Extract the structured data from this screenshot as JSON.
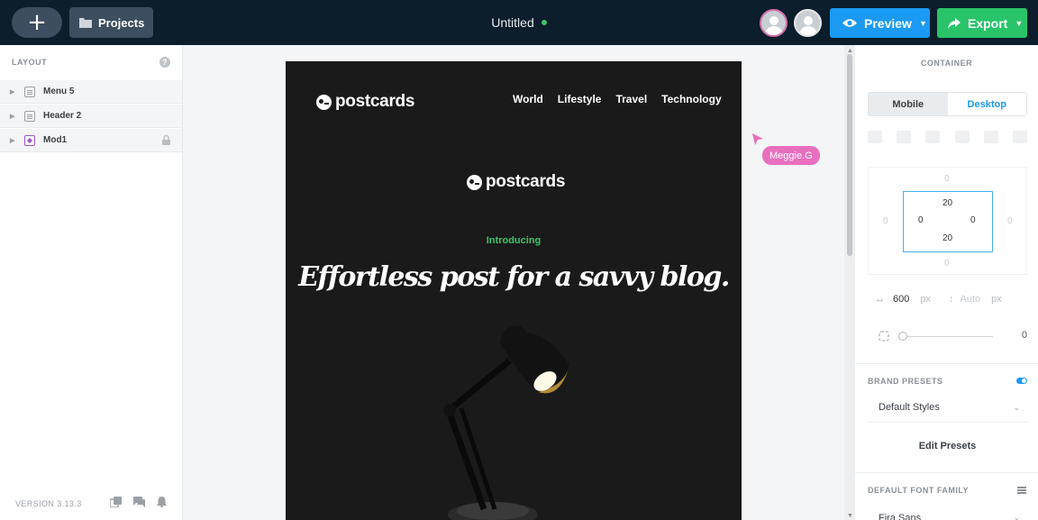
{
  "topbar": {
    "add_icon": "plus-icon",
    "projects_label": "Projects",
    "doc_title": "Untitled",
    "status_color": "#3cc46a",
    "preview_label": "Preview",
    "export_label": "Export",
    "preview_color": "#1a9af2",
    "export_color": "#29c46a"
  },
  "layout_panel": {
    "title": "LAYOUT",
    "help": "?",
    "layers": [
      {
        "label": "Menu 5",
        "icon": "section-icon"
      },
      {
        "label": "Header 2",
        "icon": "section-icon"
      },
      {
        "label": "Mod1",
        "icon": "module-icon",
        "locked": true
      }
    ],
    "version": "VERSION 3.13.3"
  },
  "canvas": {
    "logo_text": "postcards",
    "nav": [
      "World",
      "Lifestyle",
      "Travel",
      "Technology"
    ],
    "intro": "Introducing",
    "headline": "Effortless post for a savvy blog.",
    "cursor_user": "Meggie.G"
  },
  "container_panel": {
    "title": "CONTAINER",
    "tab_mobile": "Mobile",
    "tab_desktop": "Desktop",
    "margin": {
      "top": "0",
      "right": "0",
      "bottom": "0",
      "left": "0"
    },
    "padding": {
      "top": "20",
      "right": "0",
      "bottom": "20",
      "left": "0"
    },
    "width_value": "600",
    "width_unit": "px",
    "height_value": "Auto",
    "height_unit": "px",
    "radius_value": "0",
    "brand_presets_label": "BRAND PRESETS",
    "brand_presets_enabled": true,
    "preset_selected": "Default Styles",
    "edit_presets_label": "Edit Presets",
    "font_family_label": "DEFAULT FONT FAMILY",
    "font_family_value": "Fira Sans"
  }
}
